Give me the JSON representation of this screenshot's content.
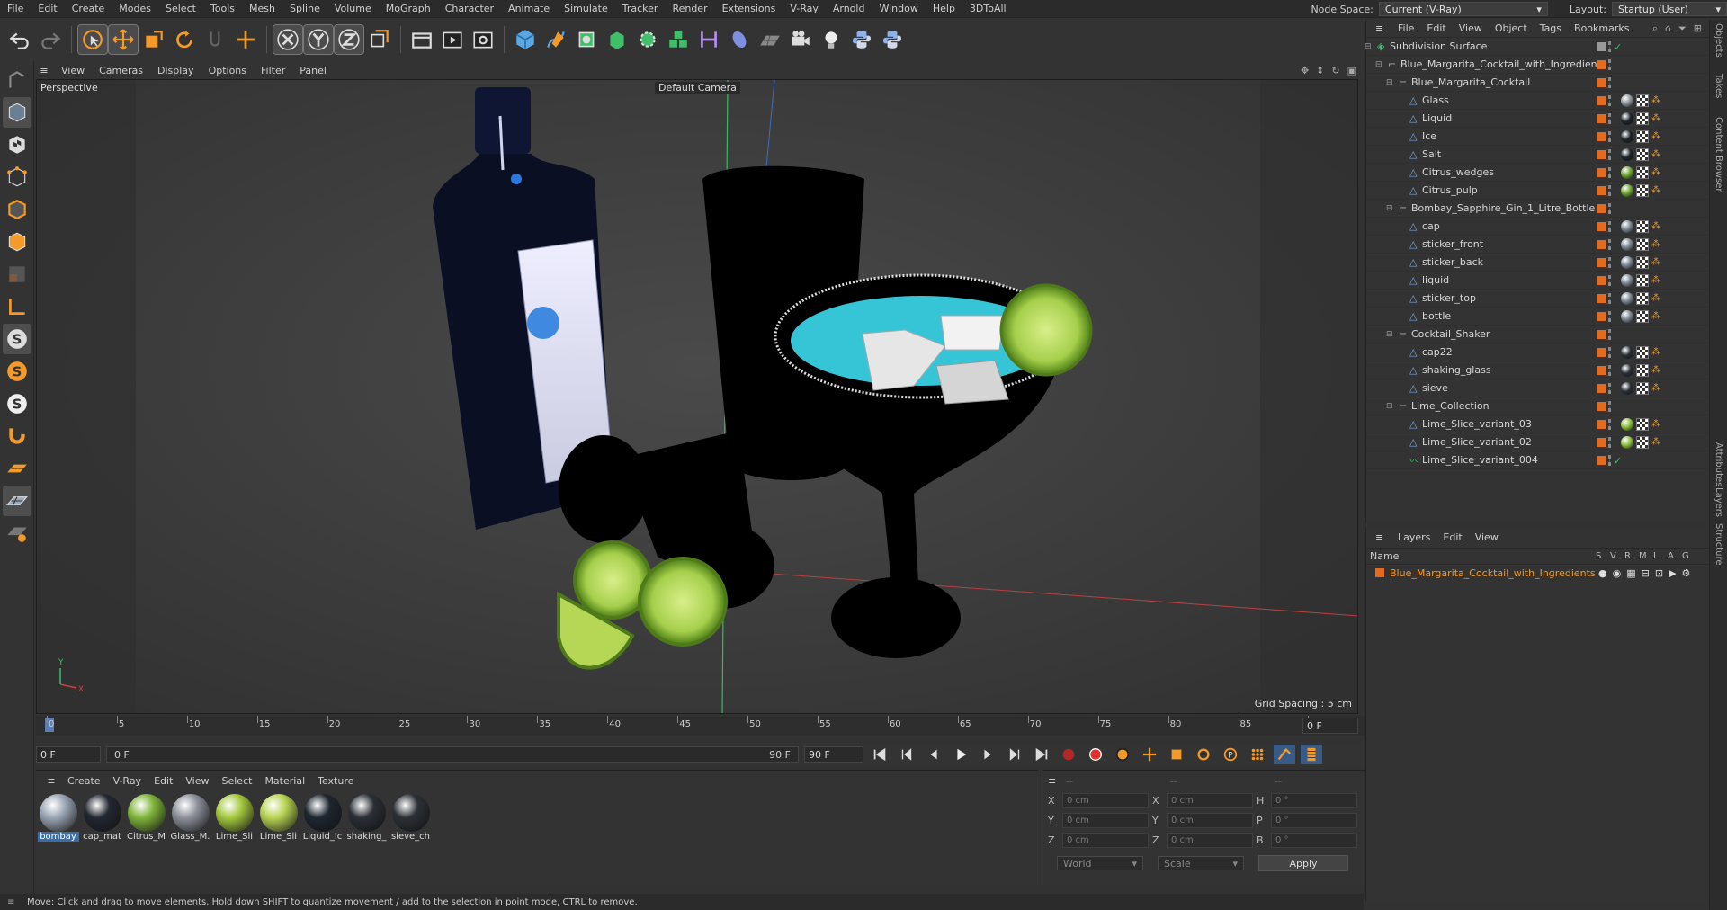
{
  "menubar": {
    "items": [
      "File",
      "Edit",
      "Create",
      "Modes",
      "Select",
      "Tools",
      "Mesh",
      "Spline",
      "Volume",
      "MoGraph",
      "Character",
      "Animate",
      "Simulate",
      "Tracker",
      "Render",
      "Extensions",
      "V-Ray",
      "Arnold",
      "Window",
      "Help",
      "3DToAll"
    ],
    "node_space_label": "Node Space:",
    "node_space_value": "Current (V-Ray)",
    "layout_label": "Layout:",
    "layout_value": "Startup (User)"
  },
  "viewport": {
    "menu": [
      "View",
      "Cameras",
      "Display",
      "Options",
      "Filter",
      "Panel"
    ],
    "label": "Perspective",
    "camera": "Default Camera",
    "grid": "Grid Spacing : 5 cm"
  },
  "timeline": {
    "ticks": [
      "0",
      "5",
      "10",
      "15",
      "20",
      "25",
      "30",
      "35",
      "40",
      "45",
      "50",
      "55",
      "60",
      "65",
      "70",
      "75",
      "80",
      "85",
      "90"
    ],
    "current_frame": "0 F",
    "start": "0 F",
    "range_start": "0 F",
    "range_end": "90 F",
    "end": "90 F"
  },
  "materials": {
    "menu": [
      "Create",
      "V-Ray",
      "Edit",
      "View",
      "Select",
      "Material",
      "Texture"
    ],
    "items": [
      {
        "label": "bombay",
        "color": "#9aa6b4"
      },
      {
        "label": "cap_mat",
        "color": "#222831"
      },
      {
        "label": "Citrus_M",
        "color": "#7fb53a"
      },
      {
        "label": "Glass_M.",
        "color": "#8c9099"
      },
      {
        "label": "Lime_Sli",
        "color": "#a4c83e"
      },
      {
        "label": "Lime_Sli",
        "color": "#b8d453"
      },
      {
        "label": "Liquid_Ic",
        "color": "#1e2630"
      },
      {
        "label": "shaking_",
        "color": "#2a2f36"
      },
      {
        "label": "sieve_ch",
        "color": "#2c3036"
      }
    ]
  },
  "coords": {
    "header": [
      "--",
      "--",
      "--"
    ],
    "rows": [
      {
        "a": "X",
        "av": "0 cm",
        "b": "X",
        "bv": "0 cm",
        "c": "H",
        "cv": "0 °"
      },
      {
        "a": "Y",
        "av": "0 cm",
        "b": "Y",
        "bv": "0 cm",
        "c": "P",
        "cv": "0 °"
      },
      {
        "a": "Z",
        "av": "0 cm",
        "b": "Z",
        "bv": "0 cm",
        "c": "B",
        "cv": "0 °"
      }
    ],
    "space": "World",
    "mode": "Scale",
    "apply": "Apply"
  },
  "status": "Move: Click and drag to move elements. Hold down SHIFT to quantize movement / add to the selection in point mode, CTRL to remove.",
  "objects": {
    "menu": [
      "File",
      "Edit",
      "View",
      "Object",
      "Tags",
      "Bookmarks"
    ],
    "rows": [
      {
        "name": "Subdivision Surface",
        "level": 0,
        "kind": "subd",
        "tag": ""
      },
      {
        "name": "Blue_Margarita_Cocktail_with_Ingredients",
        "level": 1,
        "kind": "null",
        "tag": ""
      },
      {
        "name": "Blue_Margarita_Cocktail",
        "level": 2,
        "kind": "null",
        "tag": ""
      },
      {
        "name": "Glass",
        "level": 3,
        "kind": "poly",
        "tag": "#8a9099"
      },
      {
        "name": "Liquid",
        "level": 3,
        "kind": "poly",
        "tag": "#1d232b"
      },
      {
        "name": "Ice",
        "level": 3,
        "kind": "poly",
        "tag": "#1d232b"
      },
      {
        "name": "Salt",
        "level": 3,
        "kind": "poly",
        "tag": "#1d232b"
      },
      {
        "name": "Citrus_wedges",
        "level": 3,
        "kind": "poly",
        "tag": "#6ea532"
      },
      {
        "name": "Citrus_pulp",
        "level": 3,
        "kind": "poly",
        "tag": "#6ea532"
      },
      {
        "name": "Bombay_Sapphire_Gin_1_Litre_Bottle",
        "level": 2,
        "kind": "null",
        "tag": ""
      },
      {
        "name": "cap",
        "level": 3,
        "kind": "poly",
        "tag": "#7a8592"
      },
      {
        "name": "sticker_front",
        "level": 3,
        "kind": "poly",
        "tag": "#7a8592"
      },
      {
        "name": "sticker_back",
        "level": 3,
        "kind": "poly",
        "tag": "#7a8592"
      },
      {
        "name": "liquid",
        "level": 3,
        "kind": "poly",
        "tag": "#7a8592"
      },
      {
        "name": "sticker_top",
        "level": 3,
        "kind": "poly",
        "tag": "#7a8592"
      },
      {
        "name": "bottle",
        "level": 3,
        "kind": "poly",
        "tag": "#7a8592"
      },
      {
        "name": "Cocktail_Shaker",
        "level": 2,
        "kind": "null",
        "tag": ""
      },
      {
        "name": "cap22",
        "level": 3,
        "kind": "poly",
        "tag": "#2a2f36"
      },
      {
        "name": "shaking_glass",
        "level": 3,
        "kind": "poly",
        "tag": "#2a2f36"
      },
      {
        "name": "sieve",
        "level": 3,
        "kind": "poly",
        "tag": "#2a2f36"
      },
      {
        "name": "Lime_Collection",
        "level": 2,
        "kind": "null",
        "tag": ""
      },
      {
        "name": "Lime_Slice_variant_03",
        "level": 3,
        "kind": "poly",
        "tag": "#8bbf3d"
      },
      {
        "name": "Lime_Slice_variant_02",
        "level": 3,
        "kind": "poly",
        "tag": "#8bbf3d"
      },
      {
        "name": "Lime_Slice_variant_004",
        "level": 3,
        "kind": "spline",
        "tag": ""
      }
    ]
  },
  "layers": {
    "menu": [
      "Layers",
      "Edit",
      "View"
    ],
    "header_name": "Name",
    "cols": [
      "S",
      "V",
      "R",
      "M",
      "L",
      "A",
      "G"
    ],
    "row": "Blue_Margarita_Cocktail_with_Ingredients"
  },
  "right_tabs": [
    "Objects",
    "Takes",
    "Content Browser",
    "Attributes",
    "Layers",
    "Structure"
  ]
}
